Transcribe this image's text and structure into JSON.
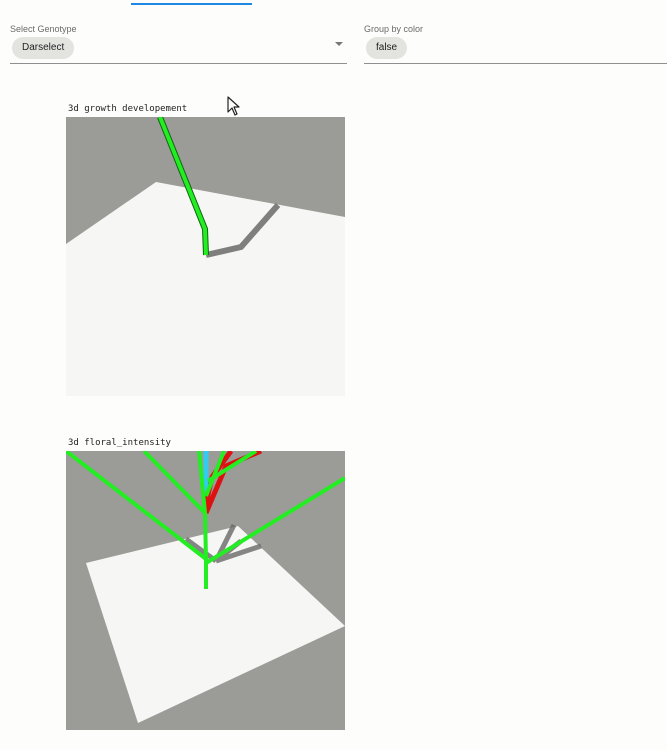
{
  "genotype_select": {
    "label": "Select Genotype",
    "value": "Darselect"
  },
  "color_group": {
    "label": "Group by color",
    "value": "false"
  },
  "plots": [
    {
      "title": "3d growth developement"
    },
    {
      "title": "3d floral_intensity"
    }
  ],
  "colors": {
    "scene_background": "#9b9b97",
    "ground": "#f6f6f4",
    "stem": "#22ee22",
    "shadow": "#6a6a68",
    "red_organ": "#dd1111",
    "cyan_organ": "#33ccee",
    "accent": "#1e88e5"
  },
  "icons": [
    "chevron-down-icon",
    "mouse-pointer-icon"
  ]
}
